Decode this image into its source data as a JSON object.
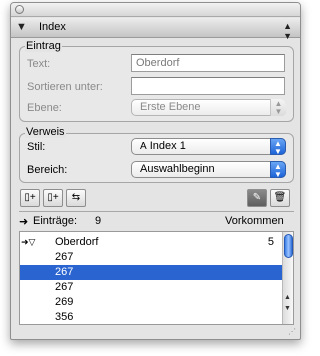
{
  "panel": {
    "title": "Index"
  },
  "eintrag": {
    "group_label": "Eintrag",
    "text_label": "Text:",
    "text_value": "Oberdorf",
    "sort_label": "Sortieren unter:",
    "sort_value": "",
    "level_label": "Ebene:",
    "level_value": "Erste Ebene"
  },
  "verweis": {
    "group_label": "Verweis",
    "style_label": "Stil:",
    "style_value": "Index 1",
    "range_label": "Bereich:",
    "range_value": "Auswahlbeginn"
  },
  "summary": {
    "entries_label": "Einträge:",
    "entries_count": "9",
    "occurrences_label": "Vorkommen"
  },
  "list": {
    "rows": [
      {
        "text": "Oberdorf",
        "count": "5",
        "selected": false,
        "expanded": true
      },
      {
        "text": "267",
        "count": "",
        "selected": false
      },
      {
        "text": "267",
        "count": "",
        "selected": true
      },
      {
        "text": "267",
        "count": "",
        "selected": false
      },
      {
        "text": "269",
        "count": "",
        "selected": false
      },
      {
        "text": "356",
        "count": "",
        "selected": false
      }
    ]
  },
  "colors": {
    "selection": "#2a64d0",
    "accent": "#1d64d8"
  },
  "icons": {
    "close": "close-icon",
    "collapse": "disclosure-triangle-icon",
    "panel_menu": "panel-menu-icon",
    "add_entry": "add-entry-icon",
    "add_all": "add-all-entries-icon",
    "goto": "goto-marker-icon",
    "edit": "pencil-icon",
    "delete": "trash-icon"
  }
}
